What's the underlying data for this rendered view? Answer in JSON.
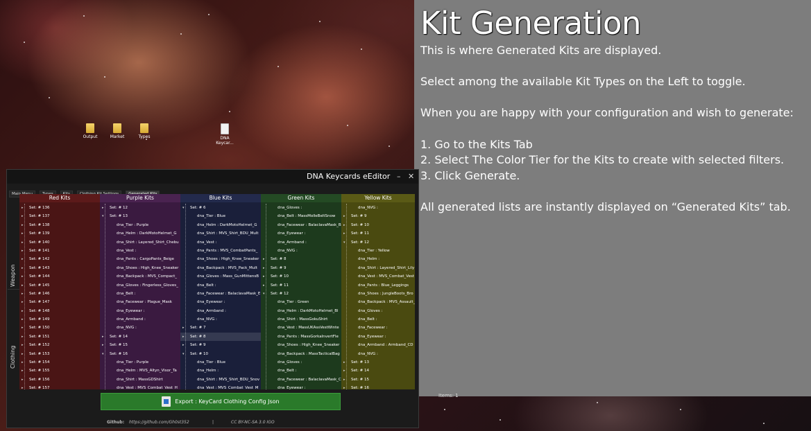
{
  "desktop": {
    "icons": [
      {
        "label": "Output",
        "kind": "folder"
      },
      {
        "label": "Market",
        "kind": "folder"
      },
      {
        "label": "Types",
        "kind": "folder"
      },
      {
        "label": "DNA Keycar...",
        "kind": "file"
      }
    ]
  },
  "info": {
    "title": "Kit Generation",
    "p1": "This is where Generated Kits are displayed.",
    "p2": "Select among the available Kit Types on the Left to toggle.",
    "p3": "When you are happy with your configuration and wish to generate:",
    "s1": "1. Go to the Kits Tab",
    "s2": "2. Select The Color Tier for the Kits to create with selected filters.",
    "s3": "3. Click Generate.",
    "p4": "All generated lists are instantly displayed on “Generated Kits” tab.",
    "status": "Items: 1"
  },
  "window": {
    "title": "DNA Keycards eEditor",
    "minimize": "–",
    "close": "✕",
    "tabs": [
      "Main Menu",
      "Types",
      "Kits",
      "Clothing Kit Settings",
      "Generated Kits"
    ],
    "active_tab": 4,
    "side_tabs": [
      "Weapon",
      "Clothing"
    ],
    "export_label": "Export : KeyCard Clothing Config Json",
    "footer": {
      "github_label": "Github:",
      "github_url": "https://github.com/Gh0st352",
      "separator": "|",
      "license": "CC BY-NC-SA 3.0 IGO"
    }
  },
  "columns": [
    {
      "key": "red",
      "title": "Red Kits",
      "bg": "#4a1515",
      "head": "#5c1a1a",
      "rows": [
        "Set: # 136",
        "Set: # 137",
        "Set: # 138",
        "Set: # 139",
        "Set: # 140",
        "Set: # 141",
        "Set: # 142",
        "Set: # 143",
        "Set: # 144",
        "Set: # 145",
        "Set: # 146",
        "Set: # 147",
        "Set: # 148",
        "Set: # 149",
        "Set: # 150",
        "Set: # 151",
        "Set: # 152",
        "Set: # 153",
        "Set: # 154",
        "Set: # 155",
        "Set: # 156",
        "Set: # 157"
      ],
      "levels": [
        0,
        0,
        0,
        0,
        0,
        0,
        0,
        0,
        0,
        0,
        0,
        0,
        0,
        0,
        0,
        0,
        0,
        0,
        0,
        0,
        0,
        0
      ],
      "expanders": [
        "▸",
        "▸",
        "▸",
        "▸",
        "▸",
        "▸",
        "▸",
        "▸",
        "▸",
        "▸",
        "▸",
        "▸",
        "▸",
        "▸",
        "▸",
        "▸",
        "▸",
        "▸",
        "▸",
        "▸",
        "▸",
        "▸"
      ]
    },
    {
      "key": "purple",
      "title": "Purple Kits",
      "bg": "#3a1a40",
      "head": "#4a2350",
      "rows": [
        "Set: # 12",
        "Set: # 13",
        "dna_Tier : Purple",
        "dna_Helm : DarkMotoHelmet_G",
        "dna_Shirt : Layered_Shirt_Chebu",
        "dna_Vest :",
        "dna_Pants : CargoPants_Beige",
        "dna_Shoes : High_Knee_Sneaker",
        "dna_Backpack : MVS_Compact_",
        "dna_Gloves : Fingerless_Gloves_",
        "dna_Belt :",
        "dna_Facewear : Plague_Mask",
        "dna_Eyewear :",
        "dna_Armband :",
        "dna_NVG :",
        "Set: # 14",
        "Set: # 15",
        "Set: # 16",
        "dna_Tier : Purple",
        "dna_Helm : MVS_Altyn_Visor_Ta",
        "dna_Shirt : MassGDShirt",
        "dna_Vest : MVS_Combat_Vest_H"
      ],
      "levels": [
        0,
        0,
        1,
        1,
        1,
        1,
        1,
        1,
        1,
        1,
        1,
        1,
        1,
        1,
        1,
        0,
        0,
        0,
        1,
        1,
        1,
        1
      ],
      "expanders": [
        "▸",
        "▾",
        "",
        "",
        "",
        "",
        "",
        "",
        "",
        "",
        "",
        "",
        "",
        "",
        "",
        "▸",
        "▸",
        "▾",
        "",
        "",
        "",
        ""
      ]
    },
    {
      "key": "blue",
      "title": "Blue Kits",
      "bg": "#1a1f3a",
      "head": "#232a4c",
      "rows": [
        "Set: # 6",
        "dna_Tier : Blue",
        "dna_Helm : DarkMotoHelmet_G",
        "dna_Shirt : MVS_Shirt_BDU_Mult",
        "dna_Vest :",
        "dna_Pants : MVS_CombatPants_",
        "dna_Shoes : High_Knee_Sneaker",
        "dna_Backpack : MVS_Pack_Mult",
        "dna_Gloves : Mass_GunMittensB",
        "dna_Belt :",
        "dna_Facewear : BalaclavaMask_E",
        "dna_Eyewear :",
        "dna_Armband :",
        "dna_NVG :",
        "Set: # 7",
        "Set: # 8",
        "Set: # 9",
        "Set: # 10",
        "dna_Tier : Blue",
        "dna_Helm :",
        "dna_Shirt : MVS_Shirt_BDU_Snov",
        "dna_Vest : MVS_Combat_Vest_M"
      ],
      "levels": [
        0,
        1,
        1,
        1,
        1,
        1,
        1,
        1,
        1,
        1,
        1,
        1,
        1,
        1,
        0,
        0,
        0,
        0,
        1,
        1,
        1,
        1
      ],
      "expanders": [
        "▾",
        "",
        "",
        "",
        "",
        "",
        "",
        "",
        "",
        "",
        "",
        "",
        "",
        "",
        "▸",
        "▸",
        "▸",
        "▾",
        "",
        "",
        "",
        ""
      ]
    },
    {
      "key": "green",
      "title": "Green Kits",
      "bg": "#1d3a1d",
      "head": "#244a24",
      "rows": [
        "dna_Gloves :",
        "dna_Belt : MassMolleBeltSnow",
        "dna_Facewear : BalaclavaMask_B",
        "dna_Eyewear :",
        "dna_Armband :",
        "dna_NVG :",
        "Set: # 8",
        "Set: # 9",
        "Set: # 10",
        "Set: # 11",
        "Set: # 12",
        "dna_Tier : Green",
        "dna_Helm : DarkMotoHelmet_Bl",
        "dna_Shirt : MassGokuShirt",
        "dna_Vest : MassUKAssVestWinte",
        "dna_Pants : MassGorkaInvertFle",
        "dna_Shoes : High_Knee_Sneaker",
        "dna_Backpack : MassTacticalBag",
        "dna_Gloves :",
        "dna_Belt :",
        "dna_Facewear : BalaclavaMask_C",
        "dna_Eyewear :"
      ],
      "levels": [
        1,
        1,
        1,
        1,
        1,
        1,
        0,
        0,
        0,
        0,
        0,
        1,
        1,
        1,
        1,
        1,
        1,
        1,
        1,
        1,
        1,
        1
      ],
      "expanders": [
        "",
        "",
        "",
        "",
        "",
        "",
        "▸",
        "▸",
        "▸",
        "▸",
        "▾",
        "",
        "",
        "",
        "",
        "",
        "",
        "",
        "",
        "",
        "",
        ""
      ]
    },
    {
      "key": "yellow",
      "title": "Yellow Kits",
      "bg": "#4a4a10",
      "head": "#5a5a16",
      "rows": [
        "dna_NVG :",
        "Set: # 9",
        "Set: # 10",
        "Set: # 11",
        "Set: # 12",
        "dna_Tier : Yellow",
        "dna_Helm :",
        "dna_Shirt : Layered_Shirt_Lily",
        "dna_Vest : MVS_Combat_Vest",
        "dna_Pants : Blue_Leggings",
        "dna_Shoes : JungleBoots_Bro",
        "dna_Backpack : MVS_Assault_",
        "dna_Gloves :",
        "dna_Belt :",
        "dna_Facewear :",
        "dna_Eyewear :",
        "dna_Armband : Armband_CD",
        "dna_NVG :",
        "Set: # 13",
        "Set: # 14",
        "Set: # 15",
        "Set: # 16"
      ],
      "levels": [
        1,
        0,
        0,
        0,
        0,
        1,
        1,
        1,
        1,
        1,
        1,
        1,
        1,
        1,
        1,
        1,
        1,
        1,
        0,
        0,
        0,
        0
      ],
      "expanders": [
        "",
        "▸",
        "▸",
        "▸",
        "▾",
        "",
        "",
        "",
        "",
        "",
        "",
        "",
        "",
        "",
        "",
        "",
        "",
        "",
        "▸",
        "▸",
        "▸",
        "▸"
      ]
    }
  ]
}
